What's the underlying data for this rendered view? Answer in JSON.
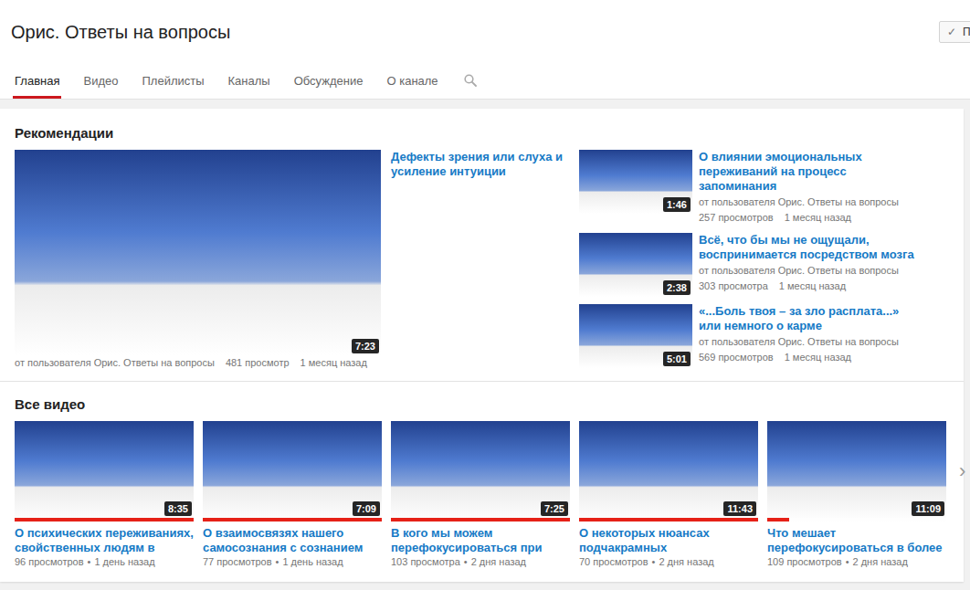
{
  "channel": {
    "title": "Орис. Ответы на вопросы",
    "subscribe": {
      "icon": "✓",
      "label": "П"
    }
  },
  "tabs": [
    {
      "label": "Главная",
      "selected": true
    },
    {
      "label": "Видео",
      "selected": false
    },
    {
      "label": "Плейлисты",
      "selected": false
    },
    {
      "label": "Каналы",
      "selected": false
    },
    {
      "label": "Обсуждение",
      "selected": false
    },
    {
      "label": "О канале",
      "selected": false
    }
  ],
  "recommendations": {
    "heading": "Рекомендации",
    "main": {
      "title": "Дефекты зрения или слуха и усиление интуиции",
      "duration": "7:23",
      "author": "от пользователя Орис. Ответы на вопросы",
      "views": "481 просмотр",
      "age": "1 месяц назад"
    },
    "side": [
      {
        "title": "О влиянии эмоциональных переживаний на процесс запоминания",
        "duration": "1:46",
        "author": "от пользователя Орис. Ответы на вопросы",
        "views": "257 просмотров",
        "age": "1 месяц назад"
      },
      {
        "title": "Всё, что бы мы не ощущали, воспринимается посредством мозга",
        "duration": "2:38",
        "author": "от пользователя Орис. Ответы на вопросы",
        "views": "303 просмотра",
        "age": "1 месяц назад"
      },
      {
        "title": "«...Боль твоя – за зло расплата...» или немного о карме",
        "duration": "5:01",
        "author": "от пользователя Орис. Ответы на вопросы",
        "views": "569 просмотров",
        "age": "1 месяц назад"
      }
    ]
  },
  "all_videos": {
    "heading": "Все видео",
    "separator": "•",
    "next": "›",
    "items": [
      {
        "title": "О психических переживаниях, свойственных людям в",
        "duration": "8:35",
        "views": "96 просмотров",
        "age": "1 день назад",
        "level": 1
      },
      {
        "title": "О взаимосвязях нашего самосознания с сознанием",
        "duration": "7:09",
        "views": "77 просмотров",
        "age": "1 день назад",
        "level": 1
      },
      {
        "title": "В кого мы можем перефокусироваться при",
        "duration": "7:25",
        "views": "103 просмотра",
        "age": "2 дня назад",
        "level": 1
      },
      {
        "title": "О некоторых нюансах подчакрамных",
        "duration": "11:43",
        "views": "70 просмотров",
        "age": "2 дня назад",
        "level": 1
      },
      {
        "title": "Что мешает перефокусироваться в более",
        "duration": "11:09",
        "views": "109 просмотров",
        "age": "2 дня назад",
        "level": 0.12
      }
    ]
  }
}
